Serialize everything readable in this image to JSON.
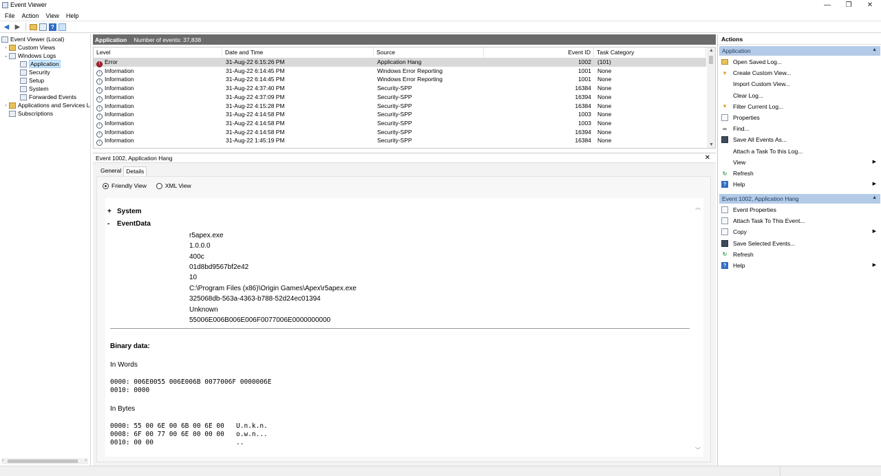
{
  "window": {
    "title": "Event Viewer"
  },
  "menu": [
    "File",
    "Action",
    "View",
    "Help"
  ],
  "tree": {
    "root": "Event Viewer (Local)",
    "custom_views": "Custom Views",
    "windows_logs": "Windows Logs",
    "logs": [
      "Application",
      "Security",
      "Setup",
      "System",
      "Forwarded Events"
    ],
    "app_services": "Applications and Services Lo",
    "subscriptions": "Subscriptions"
  },
  "log_header": {
    "name": "Application",
    "count": "Number of events: 37,838"
  },
  "columns": [
    "Level",
    "Date and Time",
    "Source",
    "Event ID",
    "Task Category"
  ],
  "events": [
    {
      "level": "Error",
      "icon": "error-icon",
      "date": "31-Aug-22 6:15:26 PM",
      "source": "Application Hang",
      "id": "1002",
      "cat": "(101)"
    },
    {
      "level": "Information",
      "icon": "info-icon",
      "date": "31-Aug-22 6:14:45 PM",
      "source": "Windows Error Reporting",
      "id": "1001",
      "cat": "None"
    },
    {
      "level": "Information",
      "icon": "info-icon",
      "date": "31-Aug-22 6:14:45 PM",
      "source": "Windows Error Reporting",
      "id": "1001",
      "cat": "None"
    },
    {
      "level": "Information",
      "icon": "info-icon",
      "date": "31-Aug-22 4:37:40 PM",
      "source": "Security-SPP",
      "id": "16384",
      "cat": "None"
    },
    {
      "level": "Information",
      "icon": "info-icon",
      "date": "31-Aug-22 4:37:09 PM",
      "source": "Security-SPP",
      "id": "16394",
      "cat": "None"
    },
    {
      "level": "Information",
      "icon": "info-icon",
      "date": "31-Aug-22 4:15:28 PM",
      "source": "Security-SPP",
      "id": "16384",
      "cat": "None"
    },
    {
      "level": "Information",
      "icon": "info-icon",
      "date": "31-Aug-22 4:14:58 PM",
      "source": "Security-SPP",
      "id": "1003",
      "cat": "None"
    },
    {
      "level": "Information",
      "icon": "info-icon",
      "date": "31-Aug-22 4:14:58 PM",
      "source": "Security-SPP",
      "id": "1003",
      "cat": "None"
    },
    {
      "level": "Information",
      "icon": "info-icon",
      "date": "31-Aug-22 4:14:58 PM",
      "source": "Security-SPP",
      "id": "16394",
      "cat": "None"
    },
    {
      "level": "Information",
      "icon": "info-icon",
      "date": "31-Aug-22 1:45:19 PM",
      "source": "Security-SPP",
      "id": "16384",
      "cat": "None"
    }
  ],
  "detail": {
    "title": "Event 1002, Application Hang",
    "tabs": [
      "General",
      "Details"
    ],
    "radio_friendly": "Friendly View",
    "radio_xml": "XML View",
    "system_label": "System",
    "system_toggle": "+",
    "eventdata_label": "EventData",
    "eventdata_toggle": "-",
    "eventdata_values": [
      "r5apex.exe",
      "1.0.0.0",
      "400c",
      "01d8bd9567bf2e42",
      "10",
      "C:\\Program Files (x86)\\Origin Games\\Apex\\r5apex.exe",
      "325068db-563a-4363-b788-52d24ec01394",
      "Unknown",
      "55006E006B006E006F0077006E0000000000"
    ],
    "binary_title": "Binary data:",
    "in_words_label": "In Words",
    "in_words": "0000: 006E0055 006E006B 0077006F 0000006E\n0010: 0000",
    "in_bytes_label": "In Bytes",
    "in_bytes": "0000: 55 00 6E 00 6B 00 6E 00   U.n.k.n.\n0008: 6F 00 77 00 6E 00 00 00   o.w.n...\n0010: 00 00                     .."
  },
  "actions": {
    "title": "Actions",
    "group1": "Application",
    "group1_items": [
      {
        "label": "Open Saved Log...",
        "icon": "folder-open-icon"
      },
      {
        "label": "Create Custom View...",
        "icon": "filter-icon"
      },
      {
        "label": "Import Custom View...",
        "icon": "none"
      },
      {
        "label": "Clear Log...",
        "icon": "none"
      },
      {
        "label": "Filter Current Log...",
        "icon": "filter-icon"
      },
      {
        "label": "Properties",
        "icon": "properties-icon"
      },
      {
        "label": "Find...",
        "icon": "binoculars-icon"
      },
      {
        "label": "Save All Events As...",
        "icon": "save-icon"
      },
      {
        "label": "Attach a Task To this Log...",
        "icon": "none"
      },
      {
        "label": "View",
        "icon": "none",
        "submenu": true
      },
      {
        "label": "Refresh",
        "icon": "refresh-icon"
      },
      {
        "label": "Help",
        "icon": "help-icon",
        "submenu": true
      }
    ],
    "group2": "Event 1002, Application Hang",
    "group2_items": [
      {
        "label": "Event Properties",
        "icon": "properties-icon"
      },
      {
        "label": "Attach Task To This Event...",
        "icon": "task-icon"
      },
      {
        "label": "Copy",
        "icon": "copy-icon",
        "submenu": true
      },
      {
        "label": "Save Selected Events...",
        "icon": "save-icon"
      },
      {
        "label": "Refresh",
        "icon": "refresh-icon"
      },
      {
        "label": "Help",
        "icon": "help-icon",
        "submenu": true
      }
    ]
  }
}
